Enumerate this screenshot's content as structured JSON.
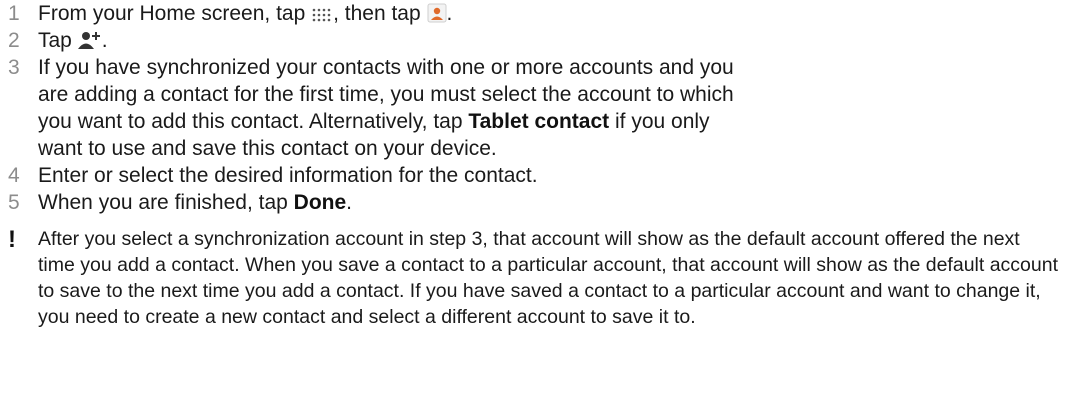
{
  "steps": [
    {
      "number": "1",
      "text_a": "From your Home screen, tap ",
      "text_b": ", then tap ",
      "text_c": ".",
      "icon_1": "apps-grid-icon",
      "icon_2": "contacts-app-icon"
    },
    {
      "number": "2",
      "text_a": "Tap ",
      "text_b": ".",
      "icon_1": "add-contact-icon"
    },
    {
      "number": "3",
      "text_a": "If you have synchronized your contacts with one or more accounts and you are adding a contact for the first time, you must select the account to which you want to add this contact. Alternatively, tap ",
      "bold": "Tablet contact",
      "text_b": " if you only want to use and save this contact on your device."
    },
    {
      "number": "4",
      "text_a": "Enter or select the desired information for the contact."
    },
    {
      "number": "5",
      "text_a": "When you are finished, tap ",
      "bold": "Done",
      "text_b": "."
    }
  ],
  "note": {
    "mark": "!",
    "text": "After you select a synchronization account in step 3, that account will show as the default account offered the next time you add a contact. When you save a contact to a particular account, that account will show as the default account to save to the next time you add a contact. If you have saved a contact to a particular account and want to change it, you need to create a new contact and select a different account to save it to."
  },
  "colors": {
    "text": "#1a1a1a",
    "step_number": "#8c8c8c",
    "contacts_icon_accent": "#e06a2a"
  }
}
